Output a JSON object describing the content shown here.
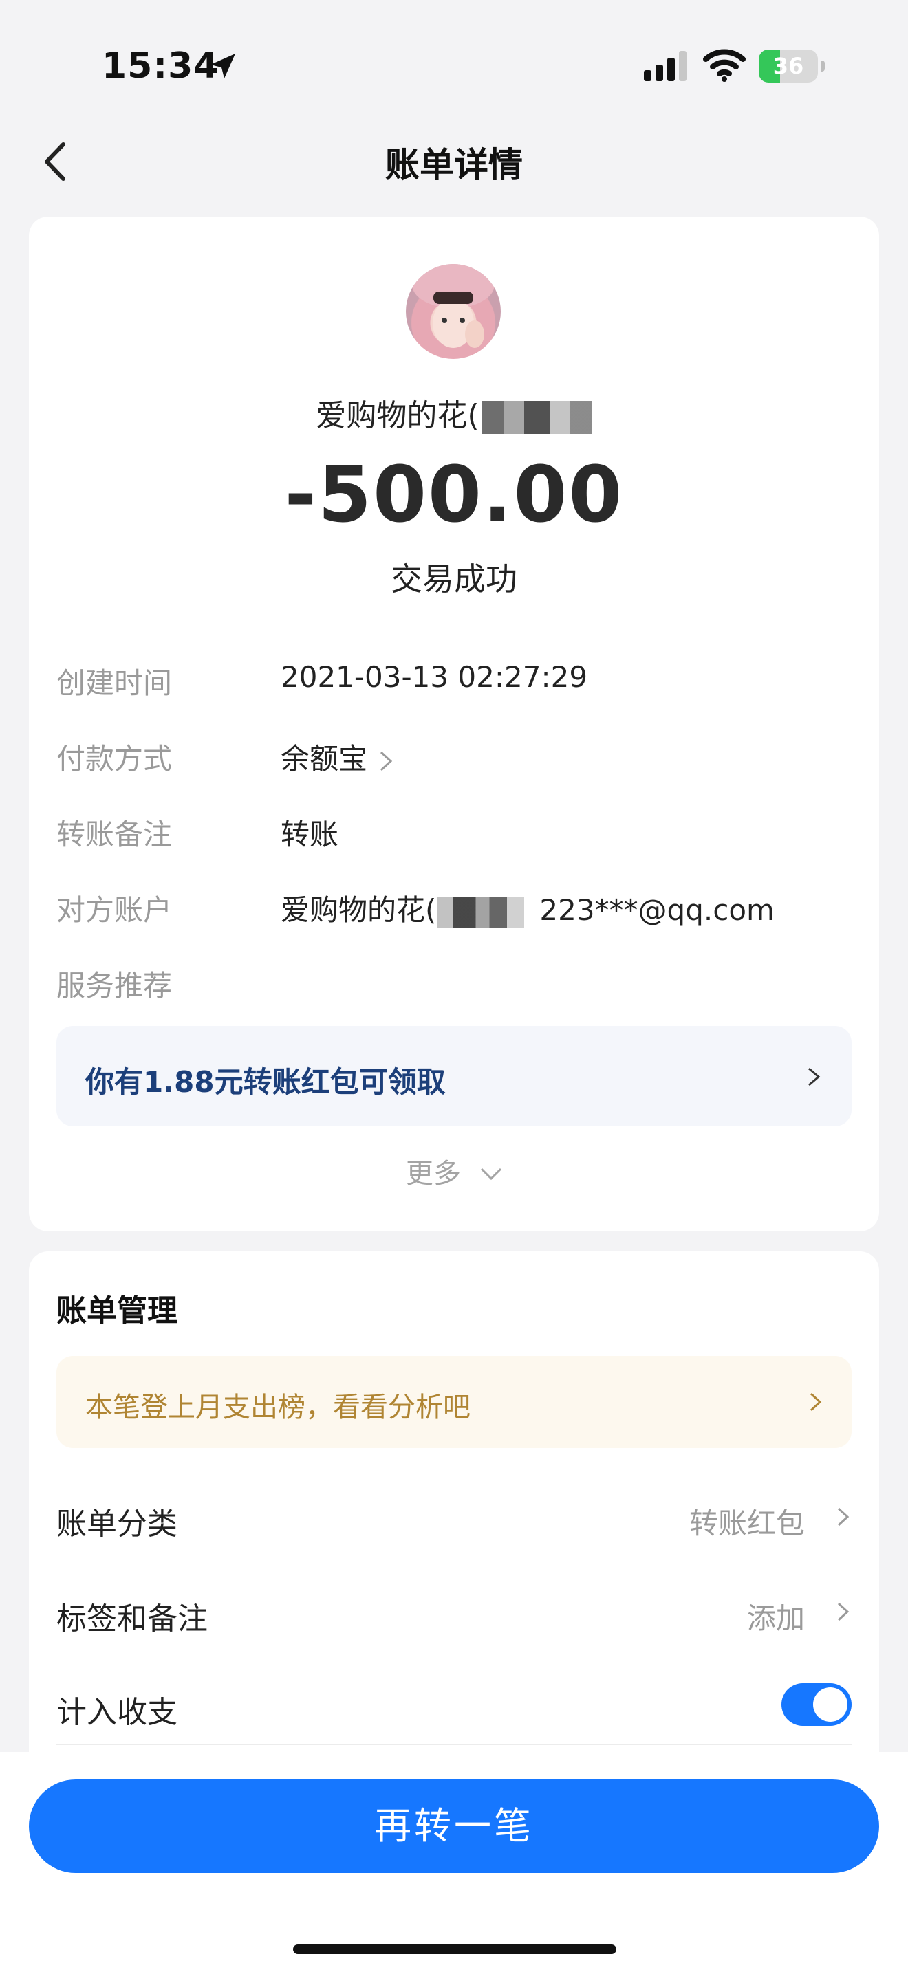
{
  "status_bar": {
    "time": "15:34",
    "battery": "36",
    "battery_level": 0.36
  },
  "nav": {
    "title": "账单详情"
  },
  "header": {
    "counterparty_name": "爱购物的花(",
    "amount": "-500.00",
    "status": "交易成功"
  },
  "details": [
    {
      "label": "创建时间",
      "value": "2021-03-13 02:27:29"
    },
    {
      "label": "付款方式",
      "value": "余额宝"
    },
    {
      "label": "转账备注",
      "value": "转账"
    },
    {
      "label": "对方账户",
      "value_name": "爱购物的花(",
      "value_email": "223***@qq.com"
    },
    {
      "label": "服务推荐"
    }
  ],
  "promo": {
    "text": "你有1.88元转账红包可领取"
  },
  "more": {
    "label": "更多"
  },
  "management": {
    "title": "账单管理",
    "notice": "本笔登上月支出榜，看看分析吧",
    "rows": [
      {
        "label": "账单分类",
        "value": "转账红包"
      },
      {
        "label": "标签和备注",
        "value": "添加"
      },
      {
        "label": "计入收支",
        "toggle": true
      }
    ]
  },
  "cta": {
    "label": "再转一笔"
  },
  "colors": {
    "accent": "#1677ff",
    "promo_text": "#1c3f7a",
    "notice_text": "#b08533",
    "battery": "#34c759"
  }
}
